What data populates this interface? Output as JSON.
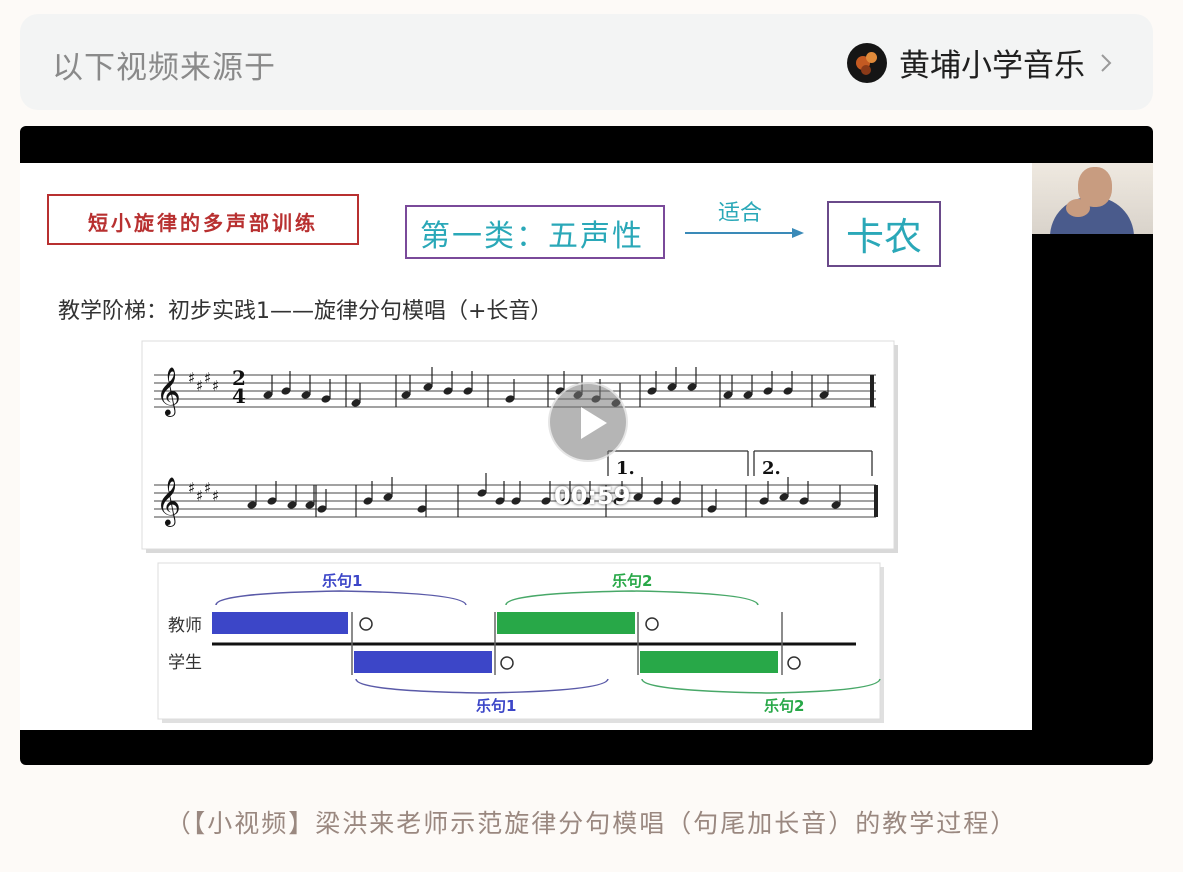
{
  "header": {
    "source_label": "以下视频来源于",
    "channel_name": "黄埔小学音乐"
  },
  "slide": {
    "title_box": "短小旋律的多声部训练",
    "category_box": "第一类：五声性",
    "arrow_label": "适合",
    "result_box": "卡农",
    "subtitle": "教学阶梯：初步实践1——旋律分句模唱（+长音）",
    "time_sig_top": "2",
    "time_sig_bottom": "4",
    "ending_1": "1.",
    "ending_2": "2.",
    "diagram": {
      "teacher_label": "教师",
      "student_label": "学生",
      "phrase_1": "乐句1",
      "phrase_2": "乐句2"
    }
  },
  "video": {
    "duration": "00:59"
  },
  "caption": "（【小视频】梁洪来老师示范旋律分句模唱（句尾加长音）的教学过程）",
  "colors": {
    "teacher_blue": "#3c46c8",
    "phrase_green": "#28a848",
    "title_red": "#b83030",
    "category_teal": "#2aa8b8"
  }
}
